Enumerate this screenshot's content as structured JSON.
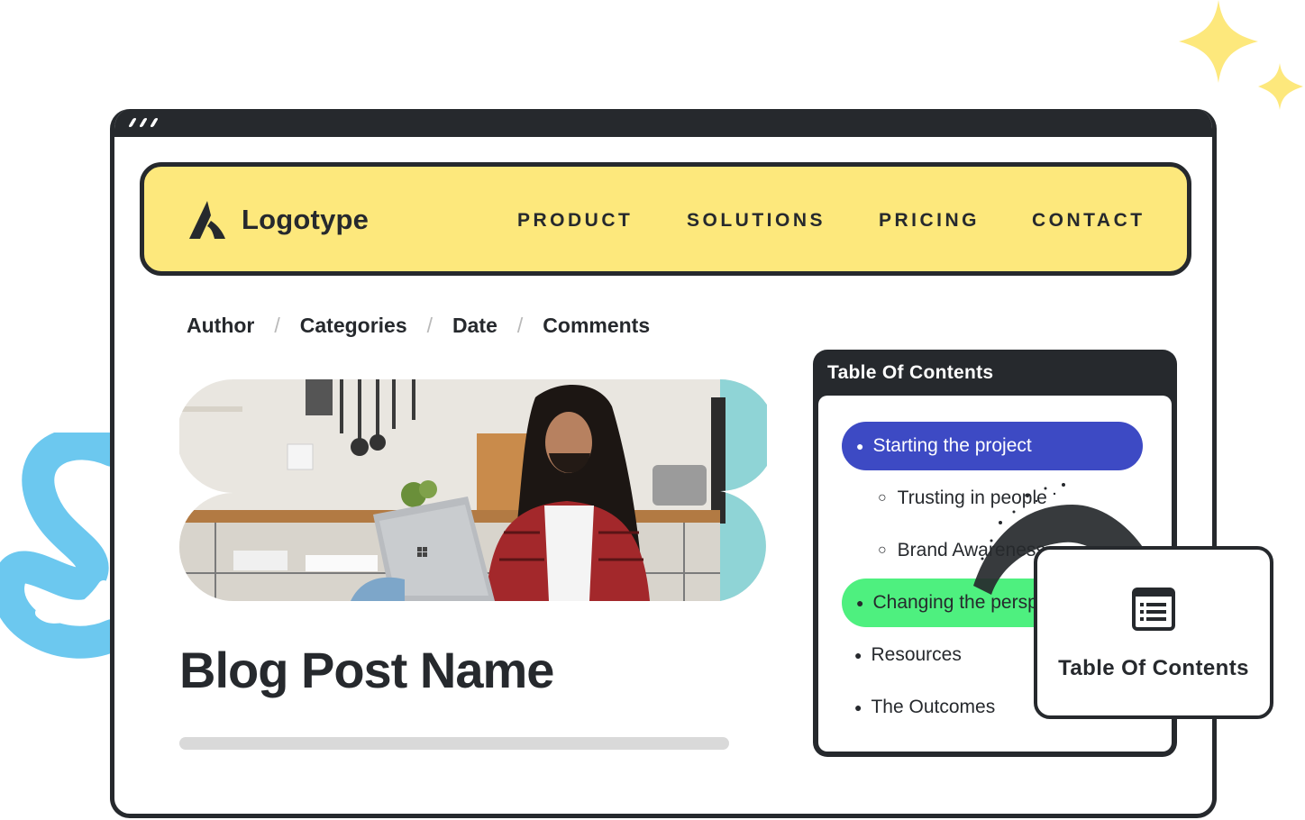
{
  "brand": {
    "logo_text": "Logotype",
    "header_bg": "#fde87c",
    "ink": "#26292d"
  },
  "nav": {
    "items": [
      {
        "label": "PRODUCT"
      },
      {
        "label": "SOLUTIONS"
      },
      {
        "label": "PRICING"
      },
      {
        "label": "CONTACT"
      }
    ]
  },
  "breadcrumb": {
    "items": [
      "Author",
      "Categories",
      "Date",
      "Comments"
    ],
    "separator": "/"
  },
  "post": {
    "title": "Blog Post Name"
  },
  "toc": {
    "header": "Table Of Contents",
    "items": [
      {
        "label": "Starting the project",
        "style": "highlight-blue",
        "color": "#3d4ac4"
      },
      {
        "label": "Trusting in people",
        "style": "sub"
      },
      {
        "label": "Brand Awareness",
        "style": "sub"
      },
      {
        "label": "Changing the perspective",
        "style": "highlight-green",
        "color": "#4ef07f"
      },
      {
        "label": "Resources",
        "style": "plain"
      },
      {
        "label": "The Outcomes",
        "style": "plain"
      }
    ]
  },
  "toc_card": {
    "label": "Table Of Contents",
    "icon": "list-icon"
  },
  "decorations": {
    "sparkle_color": "#fde87c",
    "squiggle_color": "#6cc8ef"
  }
}
